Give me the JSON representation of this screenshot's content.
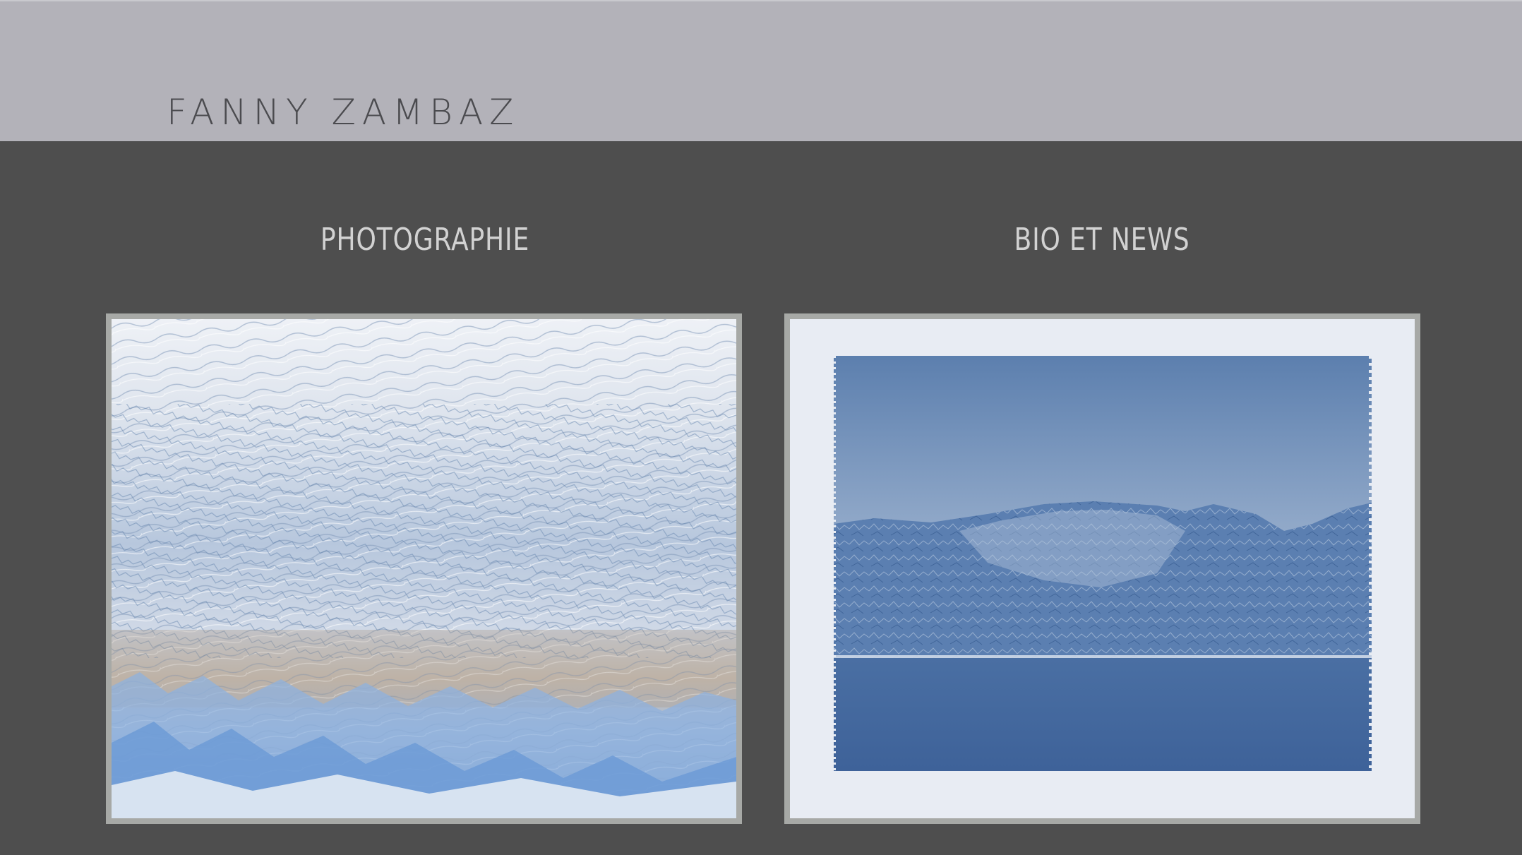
{
  "header": {
    "site_title": "FANNY ZAMBAZ",
    "background_color": "#b3b2b9"
  },
  "nav": {
    "items": [
      {
        "label": "PHOTOGRAPHIE",
        "image_icon": "glacier-photo"
      },
      {
        "label": "BIO ET NEWS",
        "image_icon": "cyanotype-cliff-photo"
      }
    ]
  },
  "theme": {
    "page_background": "#4e4e4e",
    "nav_text_color": "#d2d2d2",
    "frame_color": "#a7a9a6"
  }
}
